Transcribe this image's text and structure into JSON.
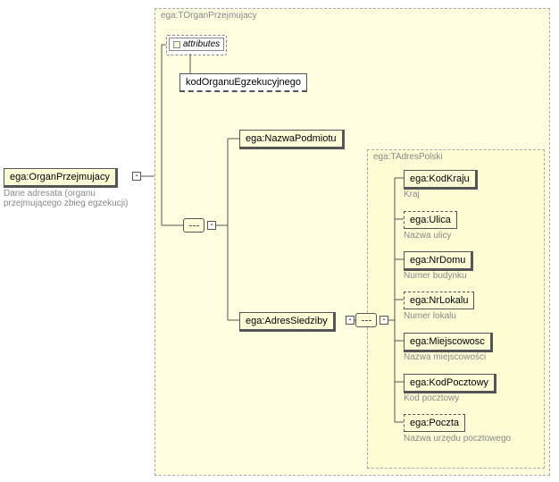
{
  "root": {
    "label": "ega:OrganPrzejmujacy",
    "caption": "Dane adresata (organu przejmującego zbieg egzekucji)"
  },
  "group1": {
    "label": "ega:TOrganPrzejmujacy"
  },
  "attributes_box": {
    "title": "attributes",
    "item": "kodOrganuEgzekucyjnego"
  },
  "children1": {
    "nazwa": {
      "label": "ega:NazwaPodmiotu"
    },
    "adres": {
      "label": "ega:AdresSiedziby"
    }
  },
  "group2": {
    "label": "ega:TAdresPolski"
  },
  "adres_children": {
    "kodKraju": {
      "label": "ega:KodKraju",
      "caption": "Kraj"
    },
    "ulica": {
      "label": "ega:Ulica",
      "caption": "Nazwa ulicy",
      "optional": true
    },
    "nrDomu": {
      "label": "ega:NrDomu",
      "caption": "Numer budynku"
    },
    "nrLokalu": {
      "label": "ega:NrLokalu",
      "caption": "Numer lokalu",
      "optional": true
    },
    "miejscowosc": {
      "label": "ega:Miejscowosc",
      "caption": "Nazwa miejscowości"
    },
    "kodPocztowy": {
      "label": "ega:KodPocztowy",
      "caption": "Kod pocztowy"
    },
    "poczta": {
      "label": "ega:Poczta",
      "caption": "Nazwa urzędu pocztowego",
      "optional": true
    }
  }
}
